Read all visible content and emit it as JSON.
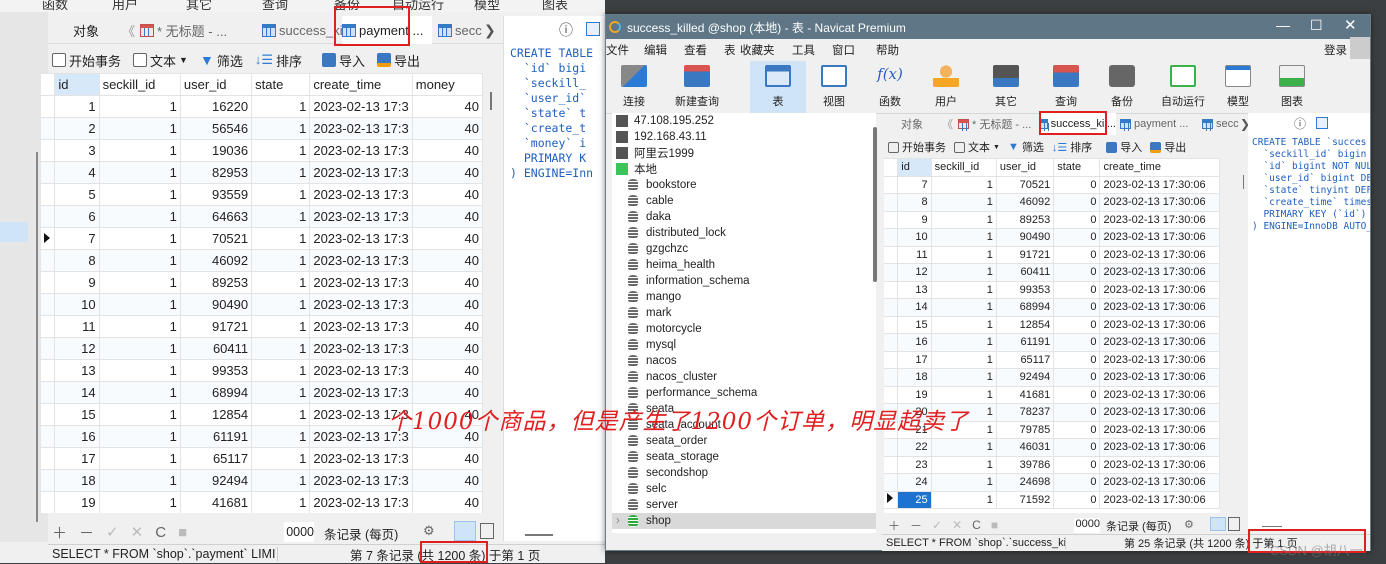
{
  "left_window": {
    "top_menu": [
      "函数",
      "用户",
      "其它",
      "查询",
      "备份",
      "自动运行",
      "模型",
      "图表"
    ],
    "tabs": [
      {
        "label": "对象",
        "icon": "none"
      },
      {
        "label": "* 无标题 - ...",
        "icon": "query-icon"
      },
      {
        "label": "success_kil...",
        "icon": "table-icon"
      },
      {
        "label": "payment ...",
        "icon": "table-icon",
        "active": true
      },
      {
        "label": "secc",
        "icon": "table-icon"
      }
    ],
    "toolbar": {
      "begin_transaction": "开始事务",
      "text": "文本",
      "filter": "筛选",
      "sort": "排序",
      "import": "导入",
      "export": "导出"
    },
    "columns": [
      "id",
      "seckill_id",
      "user_id",
      "state",
      "create_time",
      "money"
    ],
    "rows": [
      [
        "1",
        "1",
        "16220",
        "1",
        "2023-02-13 17:3",
        "40"
      ],
      [
        "2",
        "1",
        "56546",
        "1",
        "2023-02-13 17:3",
        "40"
      ],
      [
        "3",
        "1",
        "19036",
        "1",
        "2023-02-13 17:3",
        "40"
      ],
      [
        "4",
        "1",
        "82953",
        "1",
        "2023-02-13 17:3",
        "40"
      ],
      [
        "5",
        "1",
        "93559",
        "1",
        "2023-02-13 17:3",
        "40"
      ],
      [
        "6",
        "1",
        "64663",
        "1",
        "2023-02-13 17:3",
        "40"
      ],
      [
        "7",
        "1",
        "70521",
        "1",
        "2023-02-13 17:3",
        "40"
      ],
      [
        "8",
        "1",
        "46092",
        "1",
        "2023-02-13 17:3",
        "40"
      ],
      [
        "9",
        "1",
        "89253",
        "1",
        "2023-02-13 17:3",
        "40"
      ],
      [
        "10",
        "1",
        "90490",
        "1",
        "2023-02-13 17:3",
        "40"
      ],
      [
        "11",
        "1",
        "91721",
        "1",
        "2023-02-13 17:3",
        "40"
      ],
      [
        "12",
        "1",
        "60411",
        "1",
        "2023-02-13 17:3",
        "40"
      ],
      [
        "13",
        "1",
        "99353",
        "1",
        "2023-02-13 17:3",
        "40"
      ],
      [
        "14",
        "1",
        "68994",
        "1",
        "2023-02-13 17:3",
        "40"
      ],
      [
        "15",
        "1",
        "12854",
        "1",
        "2023-02-13 17:3",
        "40"
      ],
      [
        "16",
        "1",
        "61191",
        "1",
        "2023-02-13 17:3",
        "40"
      ],
      [
        "17",
        "1",
        "65117",
        "1",
        "2023-02-13 17:3",
        "40"
      ],
      [
        "18",
        "1",
        "92494",
        "1",
        "2023-02-13 17:3",
        "40"
      ],
      [
        "19",
        "1",
        "41681",
        "1",
        "2023-02-13 17:3",
        "40"
      ]
    ],
    "selected_row_id": "7",
    "ddl": [
      "CREATE TABLE",
      "  `id` bigi",
      "  `seckill_",
      "  `user_id`",
      "  `state` t",
      "  `create_t",
      "  `money` i",
      "  PRIMARY K",
      ") ENGINE=Inn"
    ],
    "page_size_value": "0000",
    "records_per_page": "条记录 (每页)",
    "status_sql": "SELECT * FROM `shop`.`payment` LIMI",
    "status_record": "第 7 条记录 (共 1200 条) 于第 1 页"
  },
  "right_window": {
    "title": "success_killed @shop (本地) - 表 - Navicat Premium",
    "menu": [
      "文件",
      "编辑",
      "查看",
      "表",
      "收藏夹",
      "工具",
      "窗口",
      "帮助"
    ],
    "login": "登录",
    "toolbar": [
      "连接",
      "新建查询",
      "表",
      "视图",
      "函数",
      "用户",
      "其它",
      "查询",
      "备份",
      "自动运行",
      "模型",
      "图表"
    ],
    "connections": [
      {
        "label": "47.108.195.252",
        "active": false
      },
      {
        "label": "192.168.43.11",
        "active": false
      },
      {
        "label": "阿里云1999",
        "active": false
      },
      {
        "label": "本地",
        "active": true
      }
    ],
    "databases": [
      "bookstore",
      "cable",
      "daka",
      "distributed_lock",
      "gzgchzc",
      "heima_health",
      "information_schema",
      "mango",
      "mark",
      "motorcycle",
      "mysql",
      "nacos",
      "nacos_cluster",
      "performance_schema",
      "seata",
      "seata_account",
      "seata_order",
      "seata_storage",
      "secondshop",
      "selc",
      "server",
      "shop"
    ],
    "selected_database": "shop",
    "tabs": [
      {
        "label": "对象"
      },
      {
        "label": "* 无标题 - ..."
      },
      {
        "label": "success_kil...",
        "active": true
      },
      {
        "label": "payment ..."
      },
      {
        "label": "secc"
      }
    ],
    "toolbar2": {
      "begin_transaction": "开始事务",
      "text": "文本",
      "filter": "筛选",
      "sort": "排序",
      "import": "导入",
      "export": "导出"
    },
    "columns": [
      "id",
      "seckill_id",
      "user_id",
      "state",
      "create_time"
    ],
    "rows": [
      [
        "7",
        "1",
        "70521",
        "0",
        "2023-02-13 17:30:06"
      ],
      [
        "8",
        "1",
        "46092",
        "0",
        "2023-02-13 17:30:06"
      ],
      [
        "9",
        "1",
        "89253",
        "0",
        "2023-02-13 17:30:06"
      ],
      [
        "10",
        "1",
        "90490",
        "0",
        "2023-02-13 17:30:06"
      ],
      [
        "11",
        "1",
        "91721",
        "0",
        "2023-02-13 17:30:06"
      ],
      [
        "12",
        "1",
        "60411",
        "0",
        "2023-02-13 17:30:06"
      ],
      [
        "13",
        "1",
        "99353",
        "0",
        "2023-02-13 17:30:06"
      ],
      [
        "14",
        "1",
        "68994",
        "0",
        "2023-02-13 17:30:06"
      ],
      [
        "15",
        "1",
        "12854",
        "0",
        "2023-02-13 17:30:06"
      ],
      [
        "16",
        "1",
        "61191",
        "0",
        "2023-02-13 17:30:06"
      ],
      [
        "17",
        "1",
        "65117",
        "0",
        "2023-02-13 17:30:06"
      ],
      [
        "18",
        "1",
        "92494",
        "0",
        "2023-02-13 17:30:06"
      ],
      [
        "19",
        "1",
        "41681",
        "0",
        "2023-02-13 17:30:06"
      ],
      [
        "20",
        "1",
        "78237",
        "0",
        "2023-02-13 17:30:06"
      ],
      [
        "21",
        "1",
        "79785",
        "0",
        "2023-02-13 17:30:06"
      ],
      [
        "22",
        "1",
        "46031",
        "0",
        "2023-02-13 17:30:06"
      ],
      [
        "23",
        "1",
        "39786",
        "0",
        "2023-02-13 17:30:06"
      ],
      [
        "24",
        "1",
        "24698",
        "0",
        "2023-02-13 17:30:06"
      ],
      [
        "25",
        "1",
        "71592",
        "0",
        "2023-02-13 17:30:06"
      ]
    ],
    "selected_row_id": "25",
    "ddl": [
      "CREATE TABLE `succes",
      "  `seckill_id` bigin",
      "  `id` bigint NOT NUL",
      "  `user_id` bigint DE",
      "  `state` tinyint DEF",
      "  `create_time` times",
      "  PRIMARY KEY (`id`)",
      ") ENGINE=InnoDB AUTO_"
    ],
    "page_size_value": "0000",
    "records_per_page": "条记录 (每页)",
    "status_sql": "SELECT * FROM `shop`.`success_killed`",
    "status_record": "第 25 条记录 (共 1200 条) 于第 1 页"
  },
  "annotation": "个1000个商品，但是产生了1200个订单，明显超卖了",
  "watermark": "CSDN @胡八一"
}
